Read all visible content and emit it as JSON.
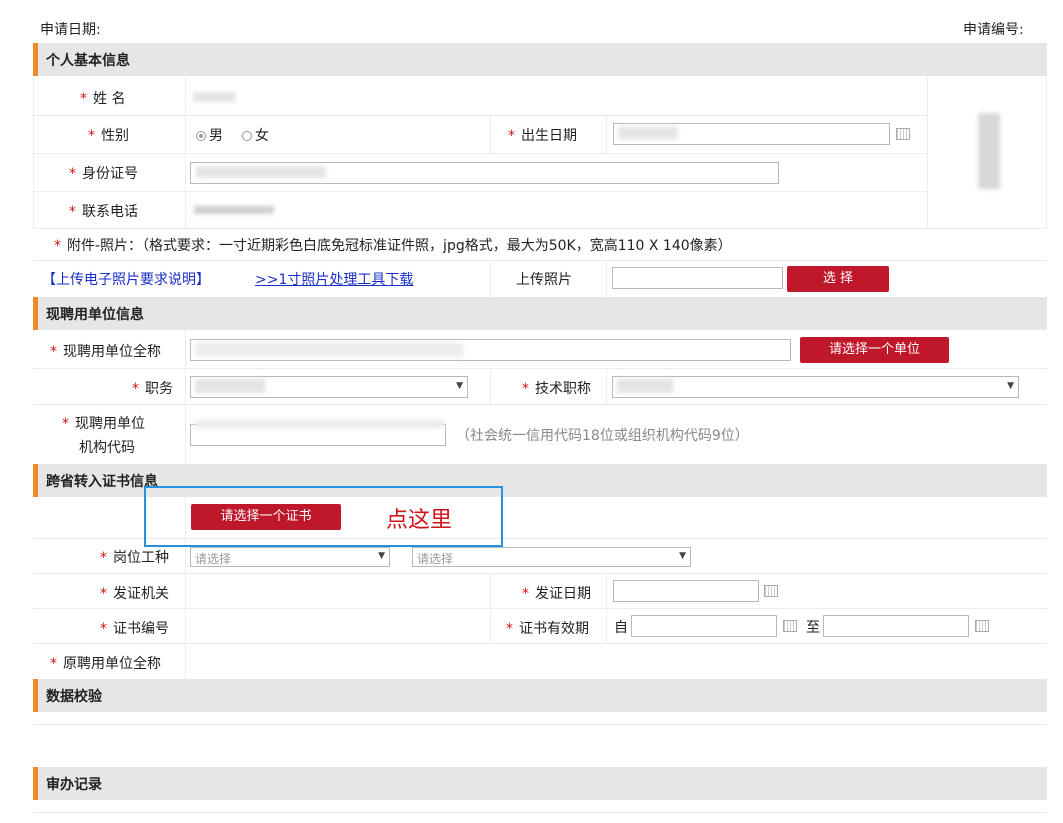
{
  "header": {
    "apply_date_label": "申请日期:",
    "apply_no_label": "申请编号:"
  },
  "colors": {
    "accent": "#f08a24",
    "button": "#c0182b",
    "required": "#d0121b",
    "highlight": "#2a8fdc"
  },
  "personal": {
    "section_title": "个人基本信息",
    "required_mark": "*",
    "name_label": "姓 名",
    "gender_label": "性别",
    "gender_male": "男",
    "gender_female": "女",
    "birth_label": "出生日期",
    "id_label": "身份证号",
    "phone_label": "联系电话",
    "photo_note": "附件-照片：（格式要求：一寸近期彩色白底免冠标准证件照，jpg格式，最大为50K，宽高110 X 140像素）",
    "photo_req_link": "【上传电子照片要求说明】",
    "photo_tool_link": ">>1寸照片处理工具下载",
    "upload_label": "上传照片",
    "select_button": "选 择"
  },
  "employer": {
    "section_title": "现聘用单位信息",
    "full_name_label": "现聘用单位全称",
    "choose_unit_button": "请选择一个单位",
    "position_label": "职务",
    "title_label": "技术职称",
    "org_code_label_1": "现聘用单位",
    "org_code_label_2": "机构代码",
    "org_code_hint": "（社会统一信用代码18位或组织机构代码9位）"
  },
  "transfer": {
    "section_title": "跨省转入证书信息",
    "choose_cert_button": "请选择一个证书",
    "annotation": "点这里",
    "post_label": "岗位工种",
    "select_placeholder_1": "请选择",
    "select_placeholder_2": "请选择",
    "issuer_label": "发证机关",
    "issue_date_label": "发证日期",
    "cert_no_label": "证书编号",
    "validity_label": "证书有效期",
    "from_label": "自",
    "to_label": "至",
    "orig_unit_label": "原聘用单位全称"
  },
  "validation": {
    "section_title": "数据校验"
  },
  "records": {
    "section_title": "审办记录"
  }
}
